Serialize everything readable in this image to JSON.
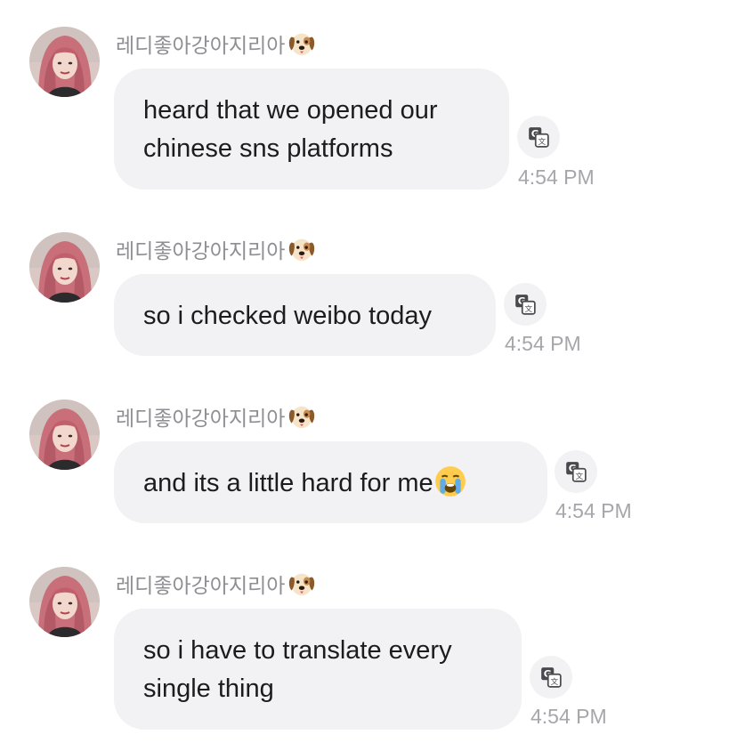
{
  "messages": [
    {
      "sender": "레디좋아강아지리아",
      "sender_emoji": "dog-face",
      "lines": [
        "heard that we opened our",
        "chinese sns platforms"
      ],
      "time": "4:54 PM"
    },
    {
      "sender": "레디좋아강아지리아",
      "sender_emoji": "dog-face",
      "lines": [
        "so i checked weibo today"
      ],
      "time": "4:54 PM"
    },
    {
      "sender": "레디좋아강아지리아",
      "sender_emoji": "dog-face",
      "lines": [
        "and its a little hard for me"
      ],
      "trailing_emoji": "loudly-crying-face",
      "time": "4:54 PM"
    },
    {
      "sender": "레디좋아강아지리아",
      "sender_emoji": "dog-face",
      "lines": [
        "so i have to translate every",
        "single thing"
      ],
      "time": "4:54 PM"
    }
  ],
  "icons": {
    "translate": "translate-icon"
  },
  "colors": {
    "bubble": "#f2f2f5",
    "sender_text": "#8e8e93",
    "time_text": "#a6a6ab",
    "message_text": "#1c1c1e"
  }
}
